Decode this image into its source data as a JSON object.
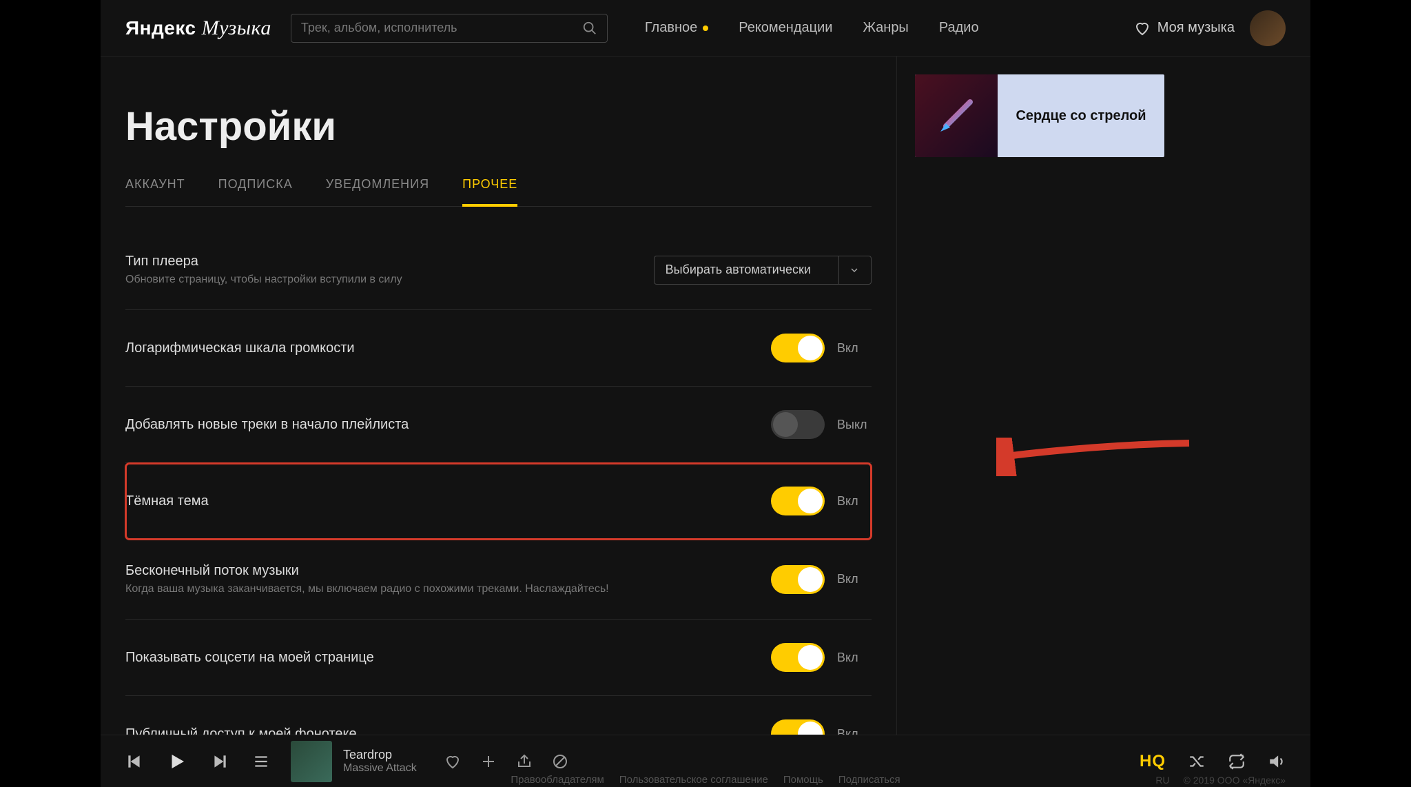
{
  "header": {
    "logo_y": "Яндекс",
    "logo_m": "Музыка",
    "search_placeholder": "Трек, альбом, исполнитель",
    "nav": {
      "main": "Главное",
      "rec": "Рекомендации",
      "genres": "Жанры",
      "radio": "Радио"
    },
    "mymusic": "Моя музыка"
  },
  "promo": {
    "text": "Сердце со стрелой"
  },
  "page": {
    "title": "Настройки",
    "tabs": {
      "account": "АККАУНТ",
      "sub": "ПОДПИСКА",
      "notif": "УВЕДОМЛЕНИЯ",
      "other": "ПРОЧЕЕ"
    }
  },
  "settings": {
    "player_type": {
      "label": "Тип плеера",
      "sub": "Обновите страницу, чтобы настройки вступили в силу",
      "value": "Выбирать автоматически"
    },
    "log_scale": {
      "label": "Логарифмическая шкала громкости",
      "state": "Вкл"
    },
    "add_new": {
      "label": "Добавлять новые треки в начало плейлиста",
      "state": "Выкл"
    },
    "dark": {
      "label": "Тёмная тема",
      "state": "Вкл"
    },
    "infinite": {
      "label": "Бесконечный поток музыки",
      "sub": "Когда ваша музыка заканчивается, мы включаем радио с похожими треками. Наслаждайтесь!",
      "state": "Вкл"
    },
    "social": {
      "label": "Показывать соцсети на моей странице",
      "state": "Вкл"
    },
    "public": {
      "label": "Публичный доступ к моей фонотеке",
      "state": "Вкл"
    }
  },
  "player": {
    "track": "Teardrop",
    "artist": "Massive Attack"
  },
  "footer": {
    "rights": "Правообладателям",
    "agreement": "Пользовательское соглашение",
    "help": "Помощь",
    "subscribe": "Подписаться",
    "lang": "RU",
    "copy": "© 2019 ООО «Яндекс»"
  }
}
